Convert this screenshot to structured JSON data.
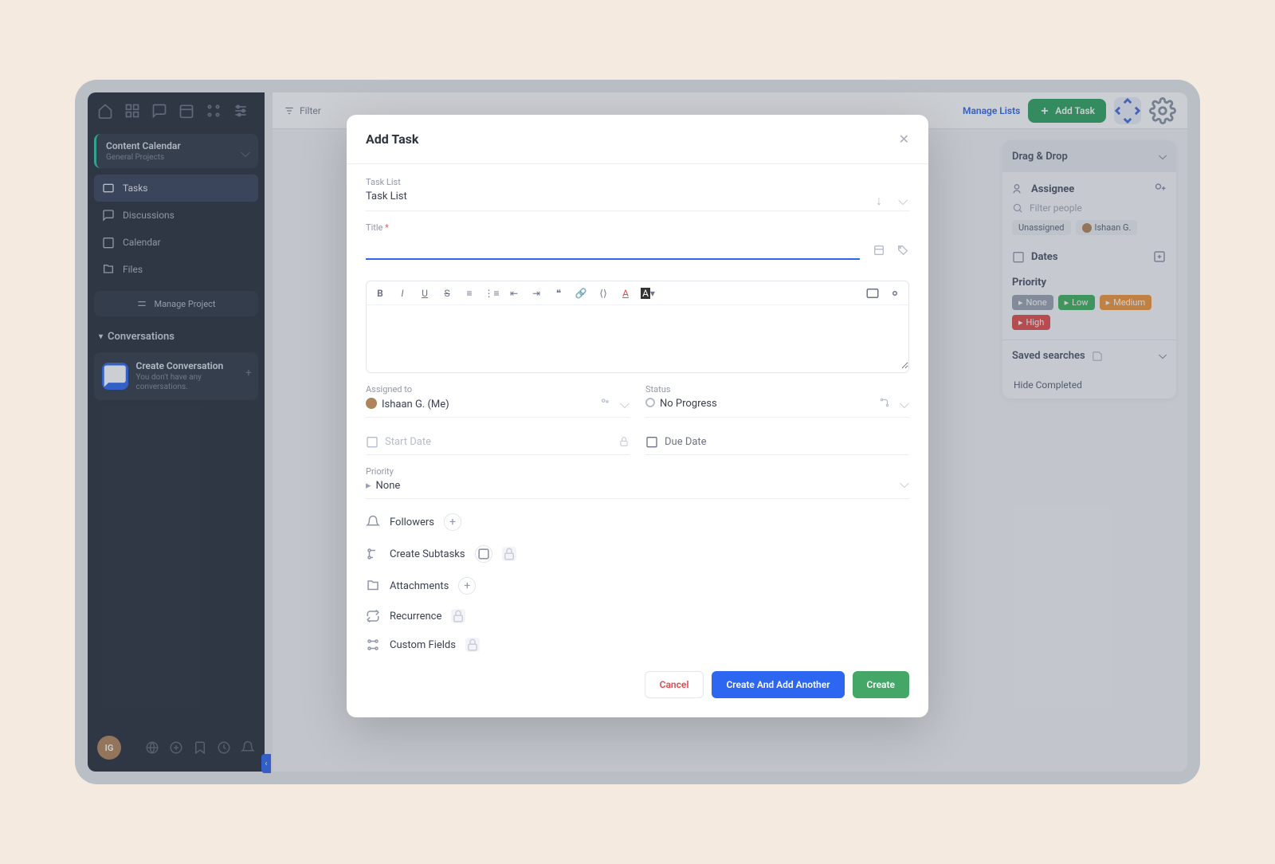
{
  "sidebar": {
    "project_name": "Content Calendar",
    "project_sub": "General Projects",
    "nav": {
      "tasks": "Tasks",
      "discussions": "Discussions",
      "calendar": "Calendar",
      "files": "Files"
    },
    "manage": "Manage Project",
    "conversations_title": "Conversations",
    "conv_title": "Create Conversation",
    "conv_sub": "You don't have any conversations.",
    "avatar": "IG"
  },
  "topbar": {
    "filter": "Filter",
    "manage_lists": "Manage Lists",
    "add_task": "Add Task"
  },
  "modal": {
    "title": "Add Task",
    "task_list_label": "Task List",
    "task_list_value": "Task List",
    "title_label": "Title",
    "title_required": "*",
    "assigned_label": "Assigned to",
    "assigned_value": "Ishaan G. (Me)",
    "status_label": "Status",
    "status_value": "No Progress",
    "start_date": "Start Date",
    "due_date": "Due Date",
    "priority_label": "Priority",
    "priority_value": "None",
    "followers": "Followers",
    "subtasks": "Create Subtasks",
    "attachments": "Attachments",
    "recurrence": "Recurrence",
    "custom_fields": "Custom Fields",
    "cancel": "Cancel",
    "create_another": "Create And Add Another",
    "create": "Create"
  },
  "rpanel": {
    "drag_drop": "Drag & Drop",
    "assignee": "Assignee",
    "filter_placeholder": "Filter people",
    "unassigned": "Unassigned",
    "person": "Ishaan G.",
    "dates": "Dates",
    "priority": "Priority",
    "p_none": "None",
    "p_low": "Low",
    "p_med": "Medium",
    "p_high": "High",
    "saved": "Saved searches",
    "hide": "Hide Completed"
  }
}
